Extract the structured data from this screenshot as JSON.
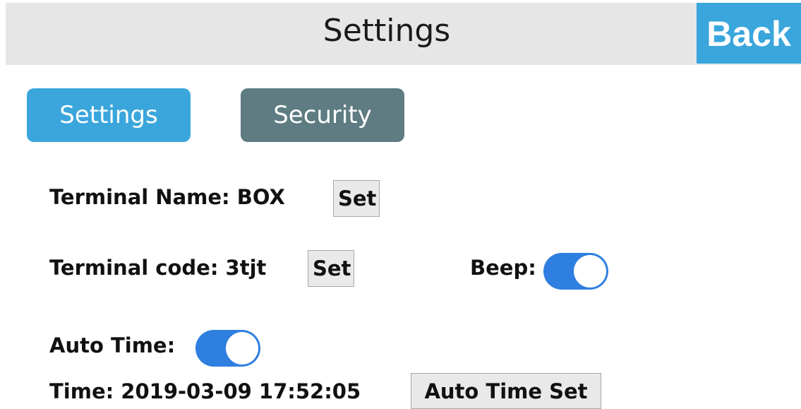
{
  "header": {
    "title": "Settings",
    "back_label": "Back"
  },
  "tabs": [
    {
      "label": "Settings",
      "active": true,
      "color": "#3aa6dc"
    },
    {
      "label": "Security",
      "active": false,
      "color": "#5e7c82"
    }
  ],
  "terminal_name": {
    "label": "Terminal Name: BOX",
    "button_label": "Set"
  },
  "terminal_code": {
    "label": "Terminal code: 3tjt",
    "button_label": "Set"
  },
  "beep": {
    "label": "Beep:",
    "on": true
  },
  "auto_time": {
    "label": "Auto Time:",
    "on": true
  },
  "time": {
    "label": "Time: 2019-03-09 17:52:05",
    "button_label": "Auto Time Set"
  },
  "colors": {
    "accent": "#3aa6dc",
    "toggle_on": "#2f7fe0",
    "header_bg": "#e6e6e6"
  }
}
